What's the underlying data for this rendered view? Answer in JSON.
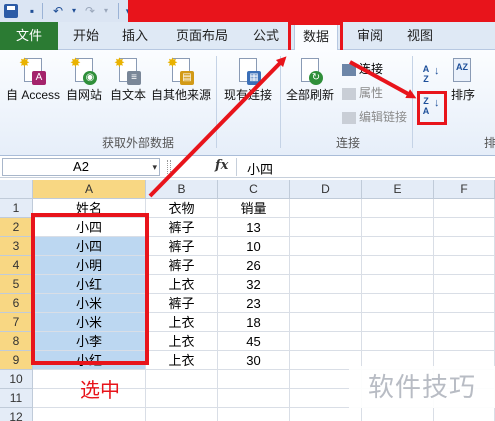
{
  "tabs": [
    "文件",
    "开始",
    "插入",
    "页面布局",
    "公式",
    "数据",
    "审阅",
    "视图"
  ],
  "ribbon": {
    "external": {
      "group_label": "获取外部数据",
      "access_label": "自 Access",
      "web_label": "自网站",
      "text_label": "自文本",
      "other_label": "自其他来源"
    },
    "existing_label": "现有连接",
    "connections": {
      "group_label": "连接",
      "refresh_label": "全部刷新",
      "connections_label": "连接",
      "properties_label": "属性",
      "edit_links_label": "编辑链接"
    },
    "sort": {
      "sort_asc_label": "A Z",
      "sort_desc_label": "Z A",
      "sort_label": "排序",
      "group_partial": "排"
    }
  },
  "formula_bar": {
    "name_box": "A2",
    "fx_label": "fx",
    "value": "小四"
  },
  "sheet": {
    "columns": [
      "A",
      "B",
      "C",
      "D",
      "E",
      "F"
    ],
    "rows": [
      "1",
      "2",
      "3",
      "4",
      "5",
      "6",
      "7",
      "8",
      "9",
      "10",
      "11",
      "12"
    ],
    "cells": [
      [
        "姓名",
        "衣物",
        "销量"
      ],
      [
        "小四",
        "裤子",
        "13"
      ],
      [
        "小四",
        "裤子",
        "10"
      ],
      [
        "小明",
        "裤子",
        "26"
      ],
      [
        "小红",
        "上衣",
        "32"
      ],
      [
        "小米",
        "裤子",
        "23"
      ],
      [
        "小米",
        "上衣",
        "18"
      ],
      [
        "小李",
        "上衣",
        "45"
      ],
      [
        "小红",
        "上衣",
        "30"
      ]
    ]
  },
  "annotation": {
    "selection_label": "选中",
    "highlight_color": "#e8141b"
  },
  "watermark": "软件技巧",
  "colors": {
    "selection_fill": "#bcd7f1",
    "header_selected": "#f8d783",
    "file_tab": "#2b7b33"
  }
}
